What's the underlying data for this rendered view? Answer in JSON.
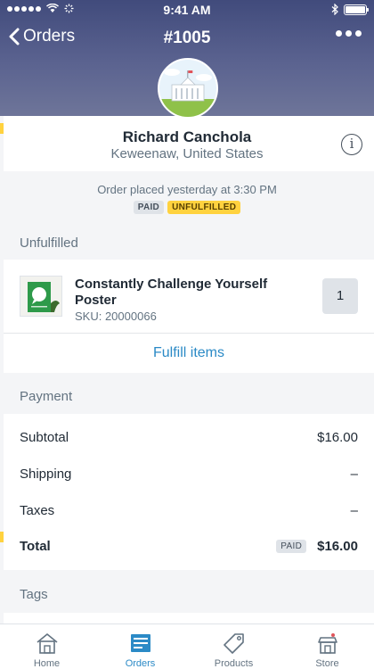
{
  "status_bar": {
    "time": "9:41 AM",
    "signal": "signal-dots-icon",
    "wifi": "wifi-icon",
    "bluetooth": "bluetooth-icon",
    "battery": "battery-icon"
  },
  "nav": {
    "back_label": "Orders",
    "title": "#1005",
    "more_icon": "ellipsis-icon"
  },
  "customer": {
    "name": "Richard Canchola",
    "location": "Keweenaw, United States",
    "info_glyph": "i"
  },
  "order": {
    "placed_text": "Order placed yesterday at 3:30 PM",
    "badges": [
      "PAID",
      "UNFULFILLED"
    ]
  },
  "unfulfilled": {
    "section_title": "Unfulfilled",
    "product_name": "Constantly Challenge Yourself Poster",
    "sku": "SKU: 20000066",
    "quantity": "1",
    "fulfill_label": "Fulfill items"
  },
  "payment": {
    "section_title": "Payment",
    "rows": [
      {
        "label": "Subtotal",
        "value": "$16.00"
      },
      {
        "label": "Shipping",
        "value": "–"
      },
      {
        "label": "Taxes",
        "value": "–"
      }
    ],
    "total_label": "Total",
    "total_badge": "PAID",
    "total_value": "$16.00"
  },
  "tags": {
    "section_title": "Tags"
  },
  "tabbar": {
    "items": [
      {
        "label": "Home",
        "icon": "home-icon"
      },
      {
        "label": "Orders",
        "icon": "orders-icon"
      },
      {
        "label": "Products",
        "icon": "tag-icon"
      },
      {
        "label": "Store",
        "icon": "store-icon"
      }
    ],
    "active": "Orders"
  },
  "colors": {
    "header": "#414b7c",
    "accent": "#2b8ac6",
    "unfulfilled_badge": "#ffd23f"
  }
}
